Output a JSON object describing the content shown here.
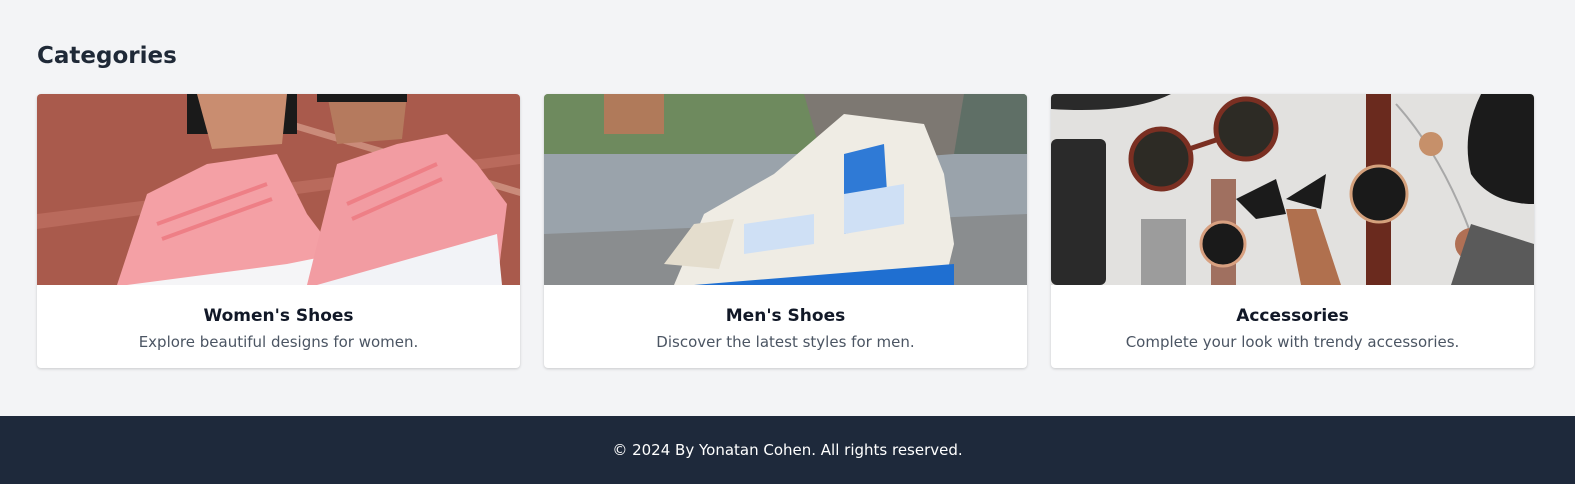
{
  "section": {
    "title": "Categories"
  },
  "categories": [
    {
      "title": "Women's Shoes",
      "description": "Explore beautiful designs for women.",
      "image_icon": "pink-sneakers-image"
    },
    {
      "title": "Men's Shoes",
      "description": "Discover the latest styles for men.",
      "image_icon": "basketball-sneaker-image"
    },
    {
      "title": "Accessories",
      "description": "Complete your look with trendy accessories.",
      "image_icon": "accessories-flatlay-image"
    }
  ],
  "footer": {
    "text": "© 2024 By Yonatan Cohen. All rights reserved."
  },
  "colors": {
    "page_bg": "#f3f4f6",
    "footer_bg": "#1e293b",
    "card_bg": "#ffffff"
  }
}
